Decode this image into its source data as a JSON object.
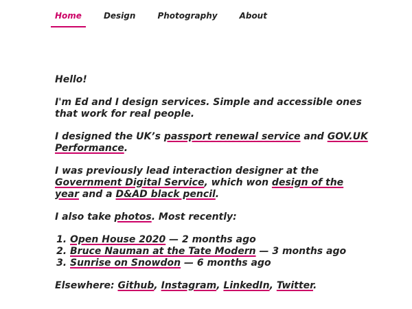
{
  "colors": {
    "accent": "#cc0066",
    "text": "#222222",
    "background": "#ffffff"
  },
  "nav": {
    "items": [
      {
        "label": "Home",
        "active": true
      },
      {
        "label": "Design",
        "active": false
      },
      {
        "label": "Photography",
        "active": false
      },
      {
        "label": "About",
        "active": false
      }
    ]
  },
  "content": {
    "greeting": "Hello!",
    "intro": "I'm Ed and I design services. Simple and accessible ones that work for real people.",
    "designed": {
      "prefix": "I designed the UK’s ",
      "link1": "passport renewal service",
      "middle": " and ",
      "link2": "GOV.UK Performance",
      "suffix": "."
    },
    "previously": {
      "prefix": "I was previously lead interaction designer at the ",
      "link1": "Government Digital Service",
      "middle1": ", which won ",
      "link2": "design of the year",
      "middle2": " and a ",
      "link3": "D&AD black pencil",
      "suffix": "."
    },
    "photos": {
      "prefix": "I also take ",
      "link": "photos",
      "suffix": ". Most recently:"
    },
    "recent": [
      {
        "title": "Open House 2020",
        "age": " — 2 months ago"
      },
      {
        "title": "Bruce Nauman at the Tate Modern",
        "age": " — 3 months ago"
      },
      {
        "title": "Sunrise on Snowdon",
        "age": " — 6 months ago"
      }
    ],
    "elsewhere": {
      "prefix": "Elsewhere: ",
      "links": [
        "Github",
        "Instagram",
        "LinkedIn",
        "Twitter"
      ],
      "separator": ", ",
      "suffix": "."
    }
  }
}
